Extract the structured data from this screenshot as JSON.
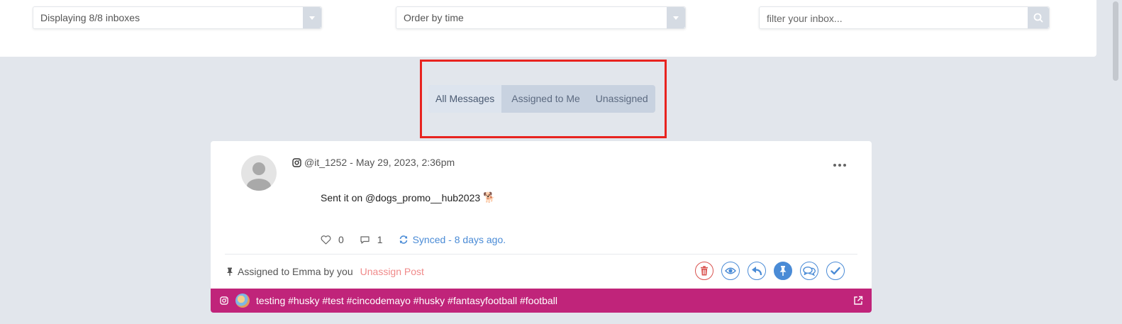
{
  "filters": {
    "inbox_select": "Displaying 8/8 inboxes",
    "order_select": "Order by time",
    "search_placeholder": "filter your inbox..."
  },
  "tabs": [
    {
      "label": "All Messages",
      "active": true
    },
    {
      "label": "Assigned to Me",
      "active": false
    },
    {
      "label": "Unassigned",
      "active": false
    }
  ],
  "message": {
    "platform_icon": "instagram-icon",
    "author": "@it_1252",
    "separator": "-",
    "timestamp": "May 29, 2023, 2:36pm",
    "text": "Sent it on  @dogs_promo__hub2023",
    "emoji": "🐕",
    "likes": "0",
    "comments": "1",
    "sync_status": "Synced - 8 days ago.",
    "assignment": "Assigned to Emma by you",
    "unassign_label": "Unassign Post",
    "actions": [
      "trash-icon",
      "eye-icon",
      "reply-icon",
      "pin-icon",
      "chat-icon",
      "check-icon"
    ]
  },
  "footer": {
    "text": "testing #husky #test #cincodemayo #husky #fantasyfootball #football",
    "color": "#c0247a"
  },
  "colors": {
    "accent": "#4a8bd6",
    "danger": "#d9534f",
    "highlight": "#e8231f",
    "background": "#e2e6ec"
  }
}
